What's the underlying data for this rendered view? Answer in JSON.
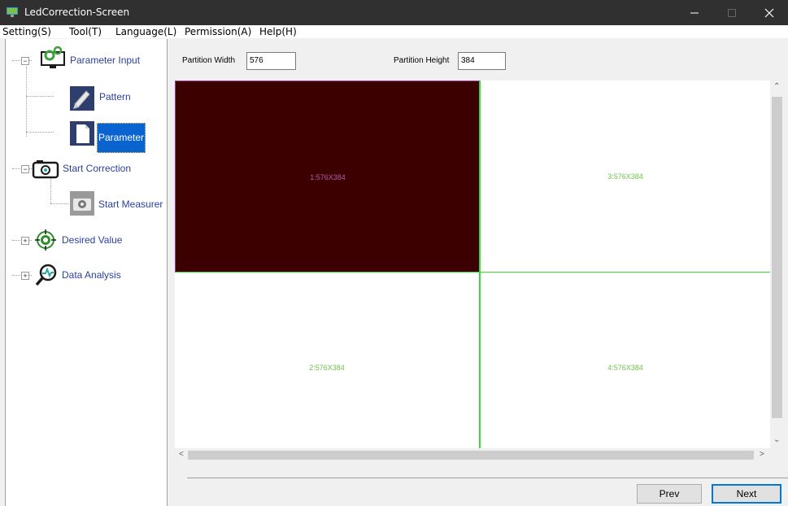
{
  "window": {
    "title": "LedCorrection-Screen",
    "controls": [
      "minimize-icon",
      "maximize-icon",
      "close-icon"
    ]
  },
  "menu": {
    "items": [
      "Setting(S)",
      "Tool(T)",
      "Language(L)",
      "Permission(A)",
      "Help(H)"
    ]
  },
  "tree": {
    "parameter_input": "Parameter Input",
    "pattern": "Pattern",
    "parameter": "Parameter",
    "start_correction": "Start Correction",
    "start_measure": "Start Measurer",
    "desired_value": "Desired Value",
    "data_analysis": "Data Analysis"
  },
  "partition": {
    "width_label": "Partition Width",
    "width_value": "576",
    "height_label": "Partition Height",
    "height_value": "384"
  },
  "grid": {
    "cells": [
      "1:576X384",
      "3:576X384",
      "2:576X384",
      "4:576X384"
    ],
    "colors": {
      "selected_fill": "#3d0000",
      "selected_text": "#b05ab0",
      "cell_text": "#6cc44a",
      "grid_line": "#33dd33",
      "selected_border": "#9a3fa3"
    }
  },
  "buttons": {
    "prev": "Prev",
    "next": "Next"
  }
}
